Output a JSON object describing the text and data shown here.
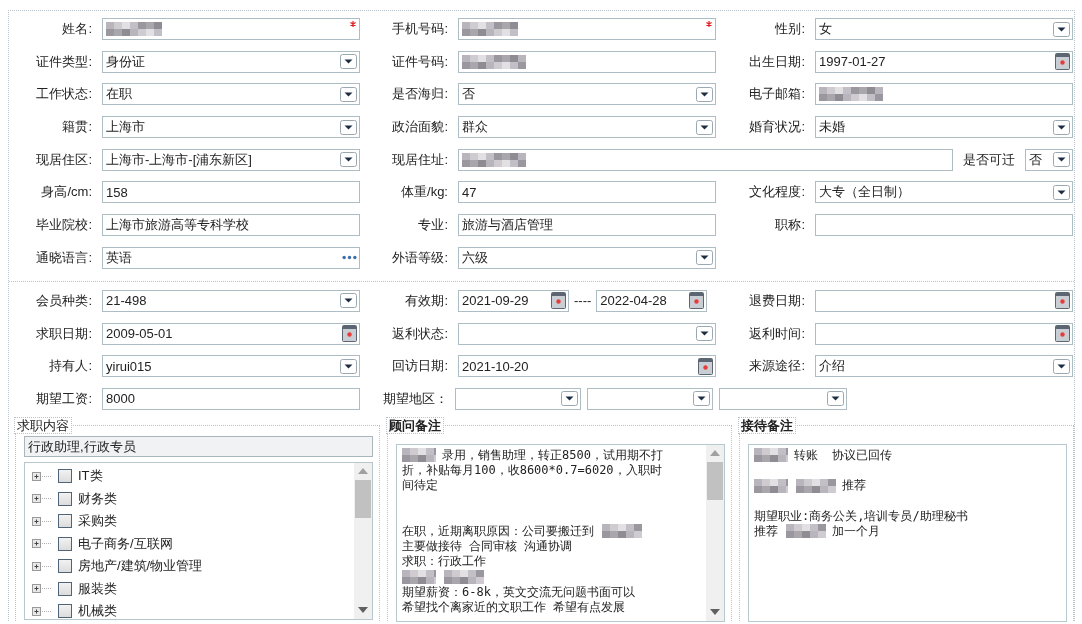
{
  "personal": {
    "rows": [
      {
        "fields": [
          {
            "label": "姓名:",
            "kind": "text",
            "redacted": true,
            "required": true
          },
          {
            "label": "手机号码:",
            "kind": "text",
            "redacted": true,
            "required": true
          },
          {
            "label": "性别:",
            "kind": "select",
            "value": "女"
          }
        ]
      },
      {
        "fields": [
          {
            "label": "证件类型:",
            "kind": "select",
            "value": "身份证"
          },
          {
            "label": "证件号码:",
            "kind": "text",
            "redacted": true
          },
          {
            "label": "出生日期:",
            "kind": "date",
            "value": "1997-01-27"
          }
        ]
      },
      {
        "fields": [
          {
            "label": "工作状态:",
            "kind": "select",
            "value": "在职"
          },
          {
            "label": "是否海归:",
            "kind": "select",
            "value": "否"
          },
          {
            "label": "电子邮箱:",
            "kind": "text",
            "redacted": true
          }
        ]
      },
      {
        "fields": [
          {
            "label": "籍贯:",
            "kind": "select",
            "value": "上海市"
          },
          {
            "label": "政治面貌:",
            "kind": "select",
            "value": "群众"
          },
          {
            "label": "婚育状况:",
            "kind": "select",
            "value": "未婚"
          }
        ]
      },
      {
        "wide_second": true,
        "fields": [
          {
            "label": "现居住区:",
            "kind": "select",
            "value": "上海市-上海市-[浦东新区]"
          },
          {
            "label": "现居住址:",
            "kind": "text",
            "redacted": true
          },
          {
            "label": "是否可迁",
            "kind": "select",
            "value": "否"
          }
        ]
      },
      {
        "fields": [
          {
            "label": "身高/cm:",
            "kind": "text",
            "value": "158"
          },
          {
            "label": "体重/kg:",
            "kind": "text",
            "value": "47"
          },
          {
            "label": "文化程度:",
            "kind": "select",
            "value": "大专（全日制）"
          }
        ]
      },
      {
        "fields": [
          {
            "label": "毕业院校:",
            "kind": "text",
            "value": "上海市旅游高等专科学校"
          },
          {
            "label": "专业:",
            "kind": "text",
            "value": "旅游与酒店管理"
          },
          {
            "label": "职称:",
            "kind": "text"
          }
        ]
      },
      {
        "fields": [
          {
            "label": "通晓语言:",
            "kind": "lookup",
            "value": "英语"
          },
          {
            "label": "外语等级:",
            "kind": "select",
            "value": "六级"
          }
        ]
      }
    ]
  },
  "membership": {
    "rows": [
      {
        "fields": [
          {
            "label": "会员种类:",
            "kind": "select",
            "value": "21-498"
          },
          {
            "label": "有效期:",
            "kind": "range",
            "values": [
              "2021-09-29",
              "2022-04-28"
            ],
            "separator": "----"
          },
          {
            "label": "退费日期:",
            "kind": "date"
          }
        ]
      },
      {
        "fields": [
          {
            "label": "求职日期:",
            "kind": "date",
            "value": "2009-05-01"
          },
          {
            "label": "返利状态:",
            "kind": "select"
          },
          {
            "label": "返利时间:",
            "kind": "date"
          }
        ]
      },
      {
        "fields": [
          {
            "label": "持有人:",
            "kind": "select",
            "value": "yirui015"
          },
          {
            "label": "回访日期:",
            "kind": "date",
            "value": "2021-10-20"
          },
          {
            "label": "来源途径:",
            "kind": "select",
            "value": "介绍"
          }
        ]
      },
      {
        "fields": [
          {
            "label": "期望工资:",
            "kind": "text",
            "value": "8000"
          },
          {
            "label": "期望地区：",
            "kind": "multi",
            "boxes": [
              {
                "kind": "select"
              },
              {
                "kind": "select"
              },
              {
                "kind": "select"
              }
            ]
          }
        ]
      }
    ]
  },
  "panels": [
    {
      "kind": "tree",
      "title": "求职内容",
      "summary": "行政助理,行政专员",
      "scrollable": true,
      "items": [
        {
          "label": "IT类",
          "checked": false,
          "expanded": false
        },
        {
          "label": "财务类",
          "checked": false,
          "expanded": false
        },
        {
          "label": "采购类",
          "checked": false,
          "expanded": false
        },
        {
          "label": "电子商务/互联网",
          "checked": false,
          "expanded": false
        },
        {
          "label": "房地产/建筑/物业管理",
          "checked": false,
          "expanded": false
        },
        {
          "label": "服装类",
          "checked": false,
          "expanded": false
        },
        {
          "label": "机械类",
          "checked": false,
          "expanded": false
        }
      ]
    },
    {
      "kind": "notes",
      "title": "顾问备注",
      "scrollable": true,
      "lines": [
        {
          "kind": "text",
          "parts": [
            {
              "kind": "blur"
            },
            {
              "kind": "text",
              "text": "录用，销售助理，转正8500，试用期不打"
            }
          ]
        },
        {
          "kind": "text",
          "parts": [
            {
              "kind": "text",
              "text": "折，补贴每月100，收8600*0.7=6020，入职时"
            }
          ]
        },
        {
          "kind": "text",
          "parts": [
            {
              "kind": "text",
              "text": "间待定"
            }
          ]
        },
        {
          "kind": "blank"
        },
        {
          "kind": "blank"
        },
        {
          "kind": "text",
          "parts": [
            {
              "kind": "text",
              "text": "在职，近期离职原因：公司要搬迁到"
            },
            {
              "kind": "blur"
            }
          ]
        },
        {
          "kind": "text",
          "parts": [
            {
              "kind": "text",
              "text": "主要做接待 合同审核 沟通协调"
            }
          ]
        },
        {
          "kind": "text",
          "parts": [
            {
              "kind": "text",
              "text": "求职：行政工作"
            }
          ]
        },
        {
          "kind": "text",
          "parts": [
            {
              "kind": "blur"
            },
            {
              "kind": "blur"
            }
          ]
        },
        {
          "kind": "text",
          "parts": [
            {
              "kind": "text",
              "text": "期望薪资：6-8k，英文交流无问题书面可以"
            }
          ]
        },
        {
          "kind": "text",
          "parts": [
            {
              "kind": "text",
              "text": "希望找个离家近的文职工作 希望有点发展"
            }
          ]
        }
      ]
    },
    {
      "kind": "notes",
      "title": "接待备注",
      "scrollable": false,
      "lines": [
        {
          "kind": "text",
          "parts": [
            {
              "kind": "blur"
            },
            {
              "kind": "text",
              "text": "转账  协议已回传"
            }
          ]
        },
        {
          "kind": "blank"
        },
        {
          "kind": "text",
          "parts": [
            {
              "kind": "blur"
            },
            {
              "kind": "blur"
            },
            {
              "kind": "text",
              "text": "推荐"
            }
          ]
        },
        {
          "kind": "blank"
        },
        {
          "kind": "text",
          "parts": [
            {
              "kind": "text",
              "text": "期望职业:商务公关,培训专员/助理秘书"
            }
          ]
        },
        {
          "kind": "text",
          "parts": [
            {
              "kind": "text",
              "text": "推荐"
            },
            {
              "kind": "blur"
            },
            {
              "kind": "text",
              "text": "加一个月"
            }
          ]
        }
      ]
    }
  ]
}
